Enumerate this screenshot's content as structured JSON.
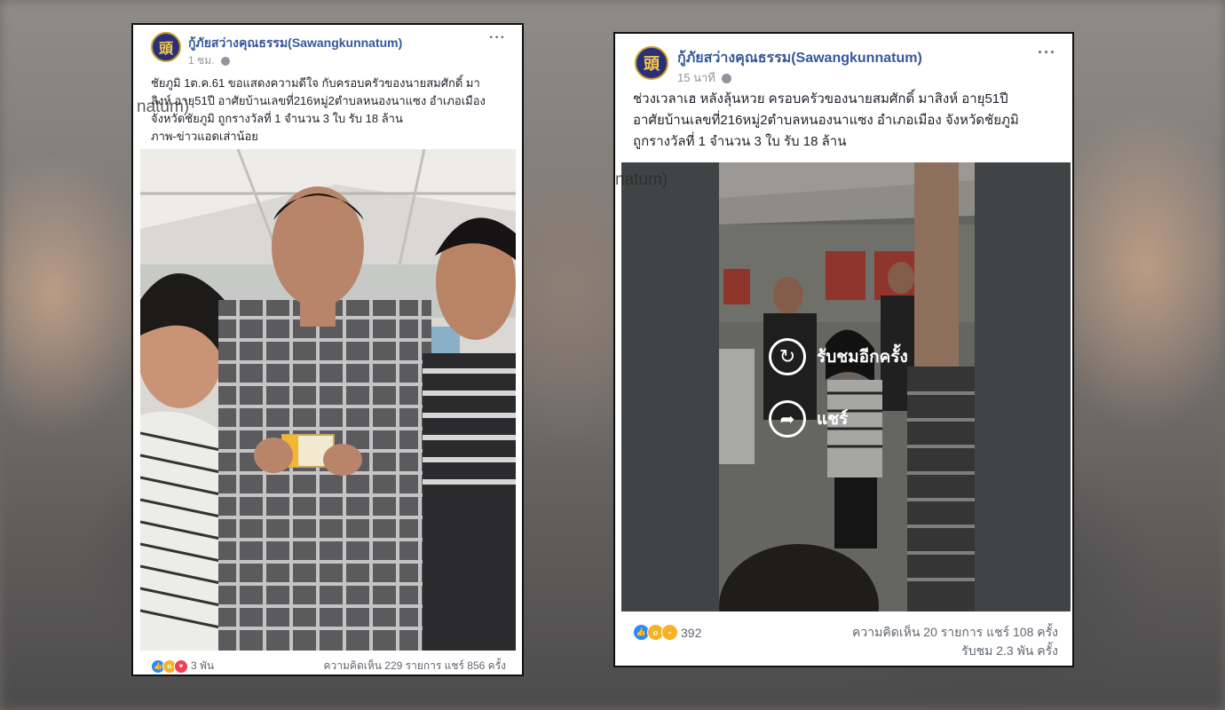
{
  "post1": {
    "page_name": "กู้ภัยสว่างคุณธรรม(Sawangkunnatum)",
    "time": "1 ชม.",
    "lines": [
      "ชัยภูมิ 1ต.ค.61 ขอแสดงความดีใจ กับครอบครัวของนายสมศักดิ์ มา",
      "ลิงห์ อายุ51ปี อาศัยบ้านเลขที่216หมู่2ตำบลหนองนาแซง อำเภอเมือง",
      "จังหวัดชัยภูมิ ถูกรางวัลที่ 1 จำนวน 3 ใบ รับ 18 ล้าน",
      "ภาพ-ข่าวแอดเส่าน้อย"
    ],
    "ghost_text": "natum)",
    "reaction_count": "3 พัน",
    "stats": "ความคิดเห็น 229 รายการ  แชร์ 856 ครั้ง"
  },
  "post2": {
    "page_name": "กู้ภัยสว่างคุณธรรม(Sawangkunnatum)",
    "time": "15 นาที",
    "lines": [
      "ช่วงเวลาเฮ หลังลุ้นหวย ครอบครัวของนายสมศักดิ์ มาสิงห์ อายุ51ปี",
      "อาศัยบ้านเลขที่216หมู่2ตำบลหนองนาแซง อำเภอเมือง จังหวัดชัยภูมิ",
      "ถูกรางวัลที่ 1 จำนวน 3 ใบ รับ 18 ล้าน"
    ],
    "ghost_text": "natum)",
    "replay_label": "รับชมอีกครั้ง",
    "share_label": "แชร์",
    "reaction_count": "392",
    "stats": "ความคิดเห็น 20 รายการ  แชร์ 108 ครั้ง",
    "views": "รับชม 2.3 พัน ครั้ง"
  },
  "icons": {
    "avatar": "rescue-logo-icon",
    "more": "more-options-icon",
    "globe": "globe-icon",
    "like": "like-icon",
    "wow": "wow-icon",
    "love": "love-icon",
    "haha": "haha-icon",
    "replay": "replay-icon",
    "share": "share-icon"
  },
  "colors": {
    "page_name": "#365899",
    "like": "#2d88ff",
    "love": "#f33e58",
    "wow": "#f7b125"
  }
}
